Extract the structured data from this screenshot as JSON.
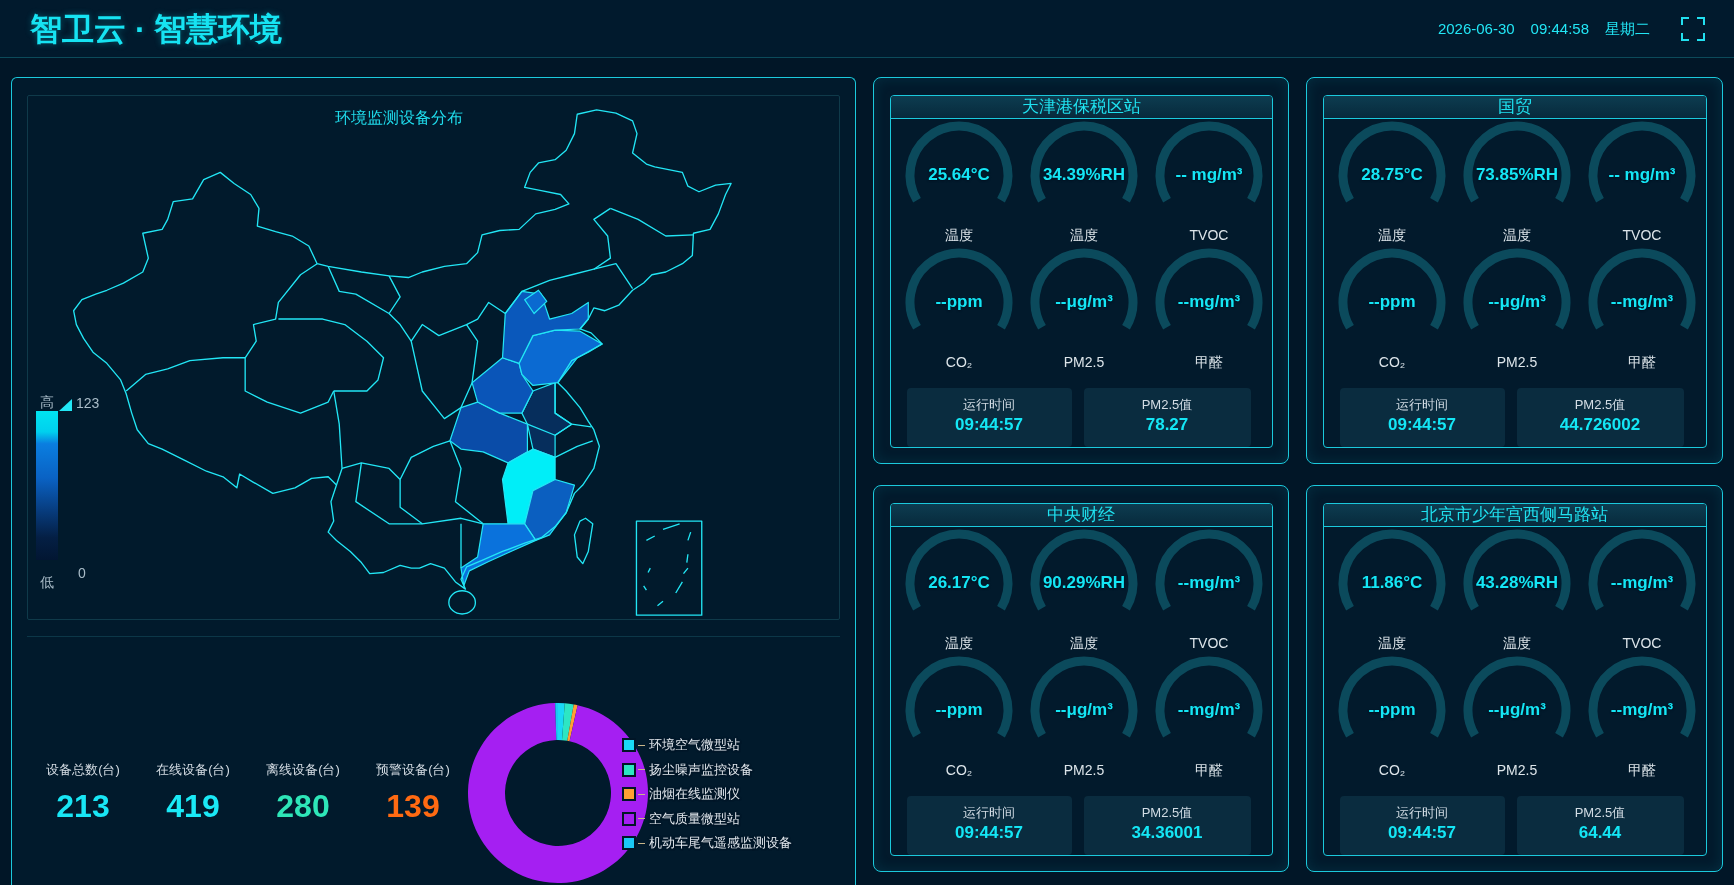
{
  "header": {
    "title": "智卫云 · 智慧环境",
    "date": "2026-06-30",
    "time": "09:44:58",
    "weekday": "星期二"
  },
  "map_panel": {
    "title": "环境监测设备分布",
    "visual_map": {
      "high_label": "高",
      "max": "123",
      "min": "0",
      "low_label": "低"
    }
  },
  "device_stats": [
    {
      "label": "设备总数(台)",
      "value": "213",
      "color": "#18e6f5"
    },
    {
      "label": "在线设备(台)",
      "value": "419",
      "color": "#1ae9f6"
    },
    {
      "label": "离线设备(台)",
      "value": "280",
      "color": "#2ee6b8"
    },
    {
      "label": "预警设备(台)",
      "value": "139",
      "color": "#ff6a12"
    }
  ],
  "device_types": {
    "legend": [
      {
        "name": "环境空气微型站",
        "color": "#1ad9f5"
      },
      {
        "name": "扬尘噪声监控设备",
        "color": "#2de6c3"
      },
      {
        "name": "油烟在线监测仪",
        "color": "#ffa033"
      },
      {
        "name": "空气质量微型站",
        "color": "#a51ff2"
      },
      {
        "name": "机动车尾气遥感监测设备",
        "color": "#1ac8f5"
      }
    ]
  },
  "stations": [
    {
      "name": "天津港保税区站",
      "gauges": [
        {
          "value": "25.64°C",
          "label": "温度"
        },
        {
          "value": "34.39%RH",
          "label": "温度"
        },
        {
          "value": "-- mg/m³",
          "label": "TVOC"
        },
        {
          "value": "--ppm",
          "label": "CO₂"
        },
        {
          "value": "--μg/m³",
          "label": "PM2.5"
        },
        {
          "value": "--mg/m³",
          "label": "甲醛"
        }
      ],
      "tiles": [
        {
          "label": "运行时间",
          "value": "09:44:57"
        },
        {
          "label": "PM2.5值",
          "value": "78.27"
        }
      ]
    },
    {
      "name": "国贸",
      "gauges": [
        {
          "value": "28.75°C",
          "label": "温度"
        },
        {
          "value": "73.85%RH",
          "label": "温度"
        },
        {
          "value": "-- mg/m³",
          "label": "TVOC"
        },
        {
          "value": "--ppm",
          "label": "CO₂"
        },
        {
          "value": "--μg/m³",
          "label": "PM2.5"
        },
        {
          "value": "--mg/m³",
          "label": "甲醛"
        }
      ],
      "tiles": [
        {
          "label": "运行时间",
          "value": "09:44:57"
        },
        {
          "label": "PM2.5值",
          "value": "44.726002"
        }
      ]
    },
    {
      "name": "中央财经",
      "gauges": [
        {
          "value": "26.17°C",
          "label": "温度"
        },
        {
          "value": "90.29%RH",
          "label": "温度"
        },
        {
          "value": "--mg/m³",
          "label": "TVOC"
        },
        {
          "value": "--ppm",
          "label": "CO₂"
        },
        {
          "value": "--μg/m³",
          "label": "PM2.5"
        },
        {
          "value": "--mg/m³",
          "label": "甲醛"
        }
      ],
      "tiles": [
        {
          "label": "运行时间",
          "value": "09:44:57"
        },
        {
          "label": "PM2.5值",
          "value": "34.36001"
        }
      ]
    },
    {
      "name": "北京市少年宫西侧马路站",
      "gauges": [
        {
          "value": "11.86°C",
          "label": "温度"
        },
        {
          "value": "43.28%RH",
          "label": "温度"
        },
        {
          "value": "--mg/m³",
          "label": "TVOC"
        },
        {
          "value": "--ppm",
          "label": "CO₂"
        },
        {
          "value": "--μg/m³",
          "label": "PM2.5"
        },
        {
          "value": "--mg/m³",
          "label": "甲醛"
        }
      ],
      "tiles": [
        {
          "label": "运行时间",
          "value": "09:44:57"
        },
        {
          "label": "PM2.5值",
          "value": "64.44"
        }
      ]
    }
  ]
}
